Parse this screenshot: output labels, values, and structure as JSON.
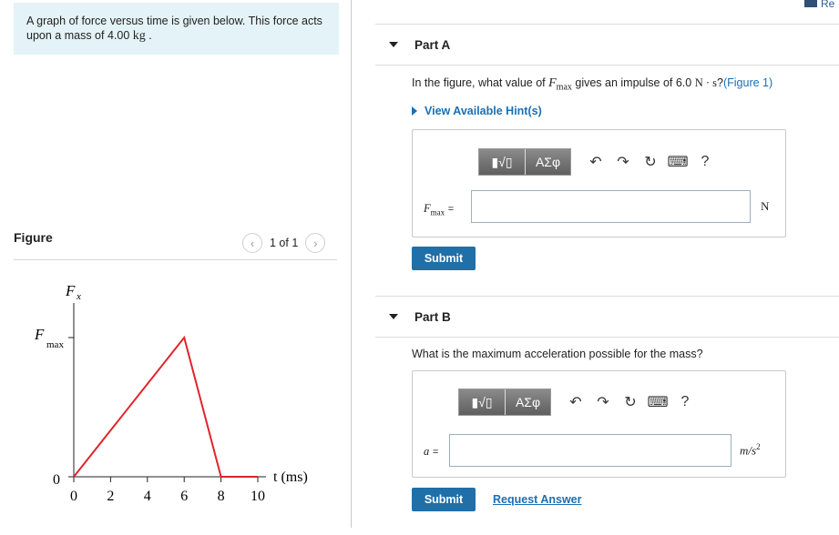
{
  "intro": {
    "text": "A graph of force versus time is given below. This force acts upon a mass of 4.00",
    "unit": "kg",
    "end": "."
  },
  "figure": {
    "title": "Figure",
    "counter": "1 of 1",
    "prev_icon": "chevron-left-icon",
    "next_icon": "chevron-right-icon"
  },
  "graph": {
    "y_axis_label": "F",
    "y_axis_sub": "x",
    "fmax_label": "F",
    "fmax_sub": "max",
    "zero_label": "0",
    "x_axis_label": "t (ms)",
    "x_ticks": [
      "0",
      "2",
      "4",
      "6",
      "8",
      "10"
    ]
  },
  "chart_data": {
    "type": "line",
    "xlabel": "t (ms)",
    "ylabel": "Fx",
    "x": [
      0,
      6,
      8,
      10
    ],
    "y": [
      0,
      1,
      0,
      0
    ],
    "y_units": "Fmax",
    "xlim": [
      0,
      10
    ],
    "x_ticks": [
      0,
      2,
      4,
      6,
      8,
      10
    ],
    "grid": false,
    "series_color": "#e0242b"
  },
  "header_mark": {
    "label": "Re"
  },
  "partA": {
    "label": "Part A",
    "q_pre": "In the figure, what value of",
    "q_var": "F",
    "q_var_sub": "max",
    "q_mid": "gives an impulse of 6.0",
    "q_unit": "N · s",
    "q_end": "?",
    "q_link": "(Figure 1)",
    "hint": "View Available Hint(s)",
    "toolbar": {
      "templates": "▮√▯",
      "symbols": "ΑΣφ",
      "help": "?"
    },
    "answer_label_var": "F",
    "answer_label_sub": "max",
    "answer_label_eq": "=",
    "answer_value": "",
    "unit": "N",
    "submit": "Submit"
  },
  "partB": {
    "label": "Part B",
    "question": "What is the maximum acceleration possible for the mass?",
    "toolbar": {
      "templates": "▮√▯",
      "symbols": "ΑΣφ",
      "help": "?"
    },
    "answer_label_var": "a",
    "answer_label_eq": "=",
    "answer_value": "",
    "unit": "m/s",
    "unit_exp": "2",
    "submit": "Submit",
    "request": "Request Answer"
  },
  "colors": {
    "accent": "#1f6fa8",
    "link": "#1a6fb5",
    "intro_bg": "#e4f3f7",
    "graph_line": "#e0242b"
  }
}
